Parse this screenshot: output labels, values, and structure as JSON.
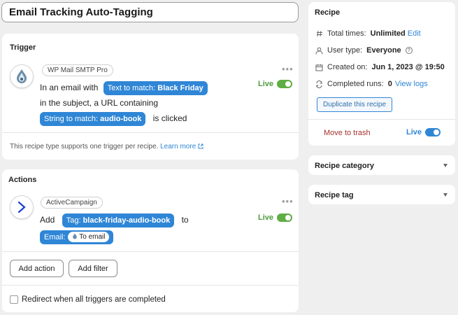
{
  "recipe_title": "Email Tracking Auto-Tagging",
  "trigger": {
    "heading": "Trigger",
    "integration": "WP Mail SMTP Pro",
    "line1_prefix": "In an email with",
    "token1_label": "Text to match:",
    "token1_value": "Black Friday",
    "line2": "in the subject, a URL containing",
    "token2_label": "String to match:",
    "token2_value": "audio-book",
    "line3_suffix": "is clicked",
    "live_label": "Live",
    "note": "This recipe type supports one trigger per recipe.",
    "learn_more": "Learn more"
  },
  "actions": {
    "heading": "Actions",
    "integration": "ActiveCampaign",
    "add_word": "Add",
    "tag_label": "Tag:",
    "tag_value": "black-friday-audio-book",
    "to_word": "to",
    "email_label": "Email:",
    "email_value": "To email",
    "live_label": "Live",
    "add_action": "Add action",
    "add_filter": "Add filter",
    "redirect_label": "Redirect when all triggers are completed"
  },
  "recipe_panel": {
    "heading": "Recipe",
    "total_times_label": "Total times:",
    "total_times_value": "Unlimited",
    "total_times_edit": "Edit",
    "user_type_label": "User type:",
    "user_type_value": "Everyone",
    "created_label": "Created on:",
    "created_value": "Jun 1, 2023 @ 19:50",
    "completed_label": "Completed runs:",
    "completed_value": "0",
    "view_logs": "View logs",
    "duplicate": "Duplicate this recipe",
    "move_to_trash": "Move to trash",
    "live_label": "Live"
  },
  "category_panel": {
    "heading": "Recipe category"
  },
  "tag_panel": {
    "heading": "Recipe tag"
  },
  "colors": {
    "accent": "#2f86d6",
    "live_green": "#4d9b3d",
    "danger": "#a4322b"
  },
  "icons": [
    "wp-mail-smtp-logo",
    "activecampaign-logo",
    "hash-icon",
    "user-icon",
    "help-icon",
    "calendar-icon",
    "refresh-icon",
    "external-link-icon",
    "more-icon",
    "chevron-down-icon"
  ]
}
